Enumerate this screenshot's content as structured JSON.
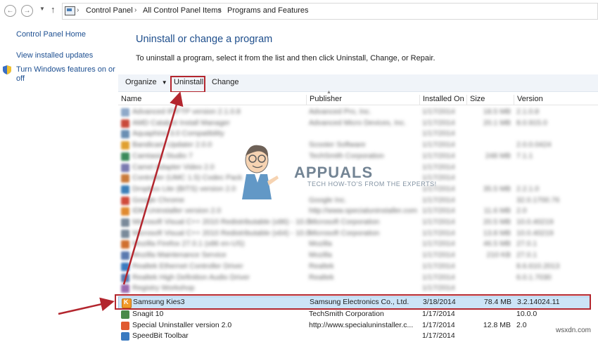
{
  "address_bar": {
    "breadcrumbs": [
      "Control Panel",
      "All Control Panel Items",
      "Programs and Features"
    ]
  },
  "left_pane": {
    "links": [
      "Control Panel Home",
      "View installed updates"
    ],
    "features_link_line1": "Turn Windows features on or",
    "features_link_line2": "off"
  },
  "main": {
    "title": "Uninstall or change a program",
    "description": "To uninstall a program, select it from the list and then click Uninstall, Change, or Repair."
  },
  "toolbar": {
    "organize_label": "Organize",
    "uninstall_label": "Uninstall",
    "change_label": "Change"
  },
  "columns": [
    "Name",
    "Publisher",
    "Installed On",
    "Size",
    "Version"
  ],
  "obscured_rows": [
    {
      "name": "Advanced IP/FTP version 2.1.0.8",
      "publisher": "Advanced Pro, Inc.",
      "date": "1/17/2014",
      "size": "18.5 MB",
      "version": "2.1.0.8"
    },
    {
      "name": "AMD Catalyst Install Manager",
      "publisher": "Advanced Micro Devices, Inc.",
      "date": "1/17/2014",
      "size": "20.1 MB",
      "version": "8.0.915.0"
    },
    {
      "name": "Aquaphine 3.0 Compatibility",
      "publisher": "",
      "date": "1/17/2014",
      "size": "",
      "version": ""
    },
    {
      "name": "Bandicam Updater 2.0.0",
      "publisher": "Scooter Software",
      "date": "1/17/2014",
      "size": "",
      "version": "2.0.0.0424"
    },
    {
      "name": "Camtasia Studio 7",
      "publisher": "TechSmith Corporation",
      "date": "1/17/2014",
      "size": "248 MB",
      "version": "7.1.1"
    },
    {
      "name": "Camel Adapter Video 2.0",
      "publisher": "",
      "date": "1/17/2014",
      "size": "",
      "version": ""
    },
    {
      "name": "Controller (UMC 1.5) Codec Pack",
      "publisher": "",
      "date": "1/17/2014",
      "size": "",
      "version": ""
    },
    {
      "name": "Dropbox Lite (BITS) version 2.0",
      "publisher": "",
      "date": "1/17/2014",
      "size": "35.5 MB",
      "version": "2.2.1.0"
    },
    {
      "name": "Google Chrome",
      "publisher": "Google Inc.",
      "date": "1/17/2014",
      "size": "",
      "version": "32.0.1700.76"
    },
    {
      "name": "IDM Uninstaller version 2.0",
      "publisher": "http://www.specialuninstaller.com",
      "date": "1/17/2014",
      "size": "11.6 MB",
      "version": "2.0"
    },
    {
      "name": "Microsoft Visual C++ 2010 Redistributable (x86) - 10.0",
      "publisher": "Microsoft Corporation",
      "date": "1/17/2014",
      "size": "20.5 MB",
      "version": "10.0.40219"
    },
    {
      "name": "Microsoft Visual C++ 2010 Redistributable (x64) - 10.0",
      "publisher": "Microsoft Corporation",
      "date": "1/17/2014",
      "size": "13.8 MB",
      "version": "10.0.40219"
    },
    {
      "name": "Mozilla Firefox 27.0.1 (x86 en-US)",
      "publisher": "Mozilla",
      "date": "1/17/2014",
      "size": "46.5 MB",
      "version": "27.0.1"
    },
    {
      "name": "Mozilla Maintenance Service",
      "publisher": "Mozilla",
      "date": "1/17/2014",
      "size": "210 KB",
      "version": "27.0.1"
    },
    {
      "name": "Realtek Ethernet Controller Driver",
      "publisher": "Realtek",
      "date": "1/17/2014",
      "size": "",
      "version": "8.6.610.2013"
    },
    {
      "name": "Realtek High Definition Audio Driver",
      "publisher": "Realtek",
      "date": "1/17/2014",
      "size": "",
      "version": "6.0.1.7030"
    },
    {
      "name": "Registry Workshop",
      "publisher": "",
      "date": "1/17/2014",
      "size": "",
      "version": ""
    }
  ],
  "selected_row": {
    "name": "Samsung Kies3",
    "publisher": "Samsung Electronics Co., Ltd.",
    "date": "3/18/2014",
    "size": "78.4 MB",
    "version": "3.2.14024.11"
  },
  "trailing_rows": [
    {
      "name": "Snagit 10",
      "publisher": "TechSmith Corporation",
      "date": "1/17/2014",
      "size": "",
      "version": "10.0.0"
    },
    {
      "name": "Special Uninstaller version 2.0",
      "publisher": "http://www.specialuninstaller.c...",
      "date": "1/17/2014",
      "size": "12.8 MB",
      "version": "2.0"
    },
    {
      "name": "SpeedBit Toolbar",
      "publisher": "",
      "date": "1/17/2014",
      "size": "",
      "version": ""
    }
  ],
  "watermark": {
    "title": "APPUALS",
    "subtitle": "TECH HOW-TO'S FROM THE EXPERTS!"
  },
  "corner_text": "wsxdn.com",
  "colors": {
    "title_blue": "#1e4e8c",
    "link_blue": "#1d4f91",
    "annotation_red": "#b3262e",
    "selection": "#cce4f7",
    "toolbar_bg": "#f0f4f9"
  }
}
